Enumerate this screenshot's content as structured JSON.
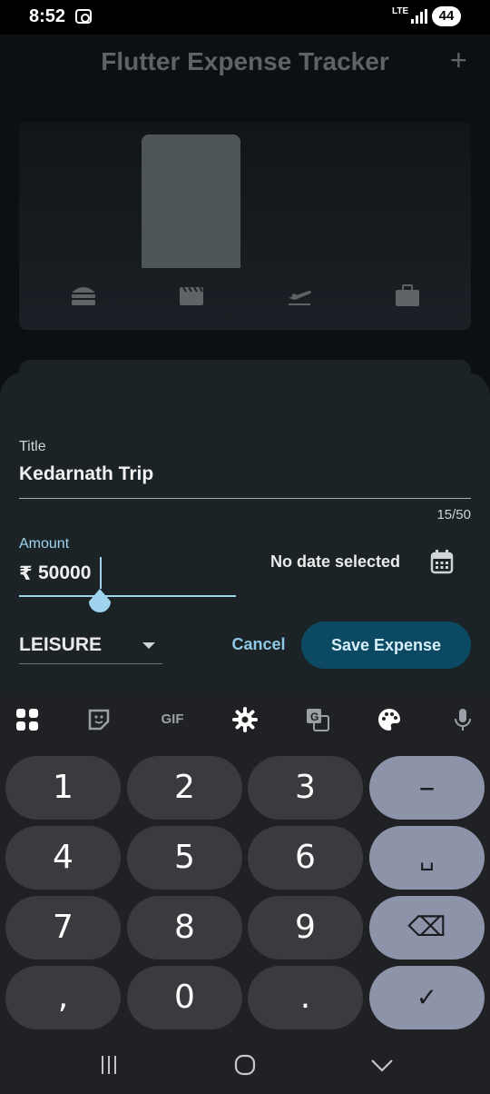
{
  "status_bar": {
    "time": "8:52",
    "network": "LTE",
    "battery": "44"
  },
  "app_bar": {
    "title": "Flutter Expense Tracker",
    "add_icon": "plus-icon"
  },
  "chart": {
    "bar_levels": [
      1.0,
      0,
      0,
      0
    ],
    "category_icons": [
      "burger-icon",
      "movie-icon",
      "flight-takeoff-icon",
      "work-briefcase-icon"
    ]
  },
  "form": {
    "title_label": "Title",
    "title_value": "Kedarnath Trip",
    "title_counter": "15/50",
    "amount_label": "Amount",
    "amount_prefix": "₹",
    "amount_value": "50000",
    "date_text": "No date selected",
    "date_icon": "calendar-icon",
    "category_value": "LEISURE",
    "cancel_label": "Cancel",
    "save_label": "Save Expense"
  },
  "keyboard": {
    "toolbar": [
      "apps-icon",
      "sticker-icon",
      "GIF",
      "settings-icon",
      "translate-icon",
      "palette-icon",
      "mic-icon"
    ],
    "keys": [
      "1",
      "2",
      "3",
      "–",
      "4",
      "5",
      "6",
      "␣",
      "7",
      "8",
      "9",
      "⌫",
      ",",
      "0",
      ".",
      "✓"
    ]
  },
  "colors": {
    "accent": "#9fd3ee",
    "save_button_bg": "#0c4a63",
    "sheet_bg": "#1b2326",
    "keyboard_bg": "#202124",
    "key_bg": "#3a3b3f",
    "action_key_bg": "#8d93a8"
  }
}
